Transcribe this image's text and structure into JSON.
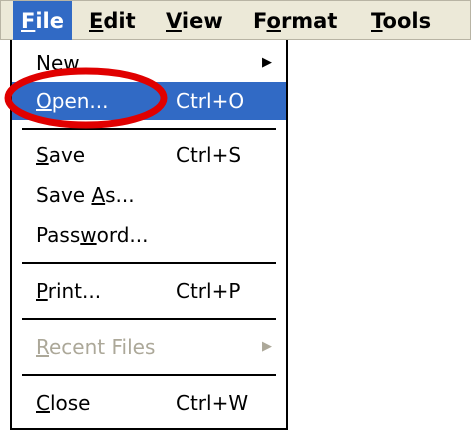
{
  "menubar": {
    "items": [
      {
        "label": "File"
      },
      {
        "label": "Edit"
      },
      {
        "label": "View"
      },
      {
        "label": "Format"
      },
      {
        "label": "Tools"
      }
    ]
  },
  "file_menu": {
    "new": {
      "label": "New",
      "icon": "chevron-right-icon"
    },
    "open": {
      "label": "Open...",
      "shortcut": "Ctrl+O"
    },
    "save": {
      "label": "Save",
      "shortcut": "Ctrl+S"
    },
    "save_as": {
      "label": "Save As..."
    },
    "password": {
      "label": "Password..."
    },
    "print": {
      "label": "Print...",
      "shortcut": "Ctrl+P"
    },
    "recent_files": {
      "label": "Recent Files",
      "icon": "chevron-right-icon"
    },
    "close": {
      "label": "Close",
      "shortcut": "Ctrl+W"
    }
  },
  "colors": {
    "highlight": "#316ac5",
    "menubar_bg": "#ece9d8",
    "disabled_text": "#aca899",
    "annotation": "#e00000"
  }
}
